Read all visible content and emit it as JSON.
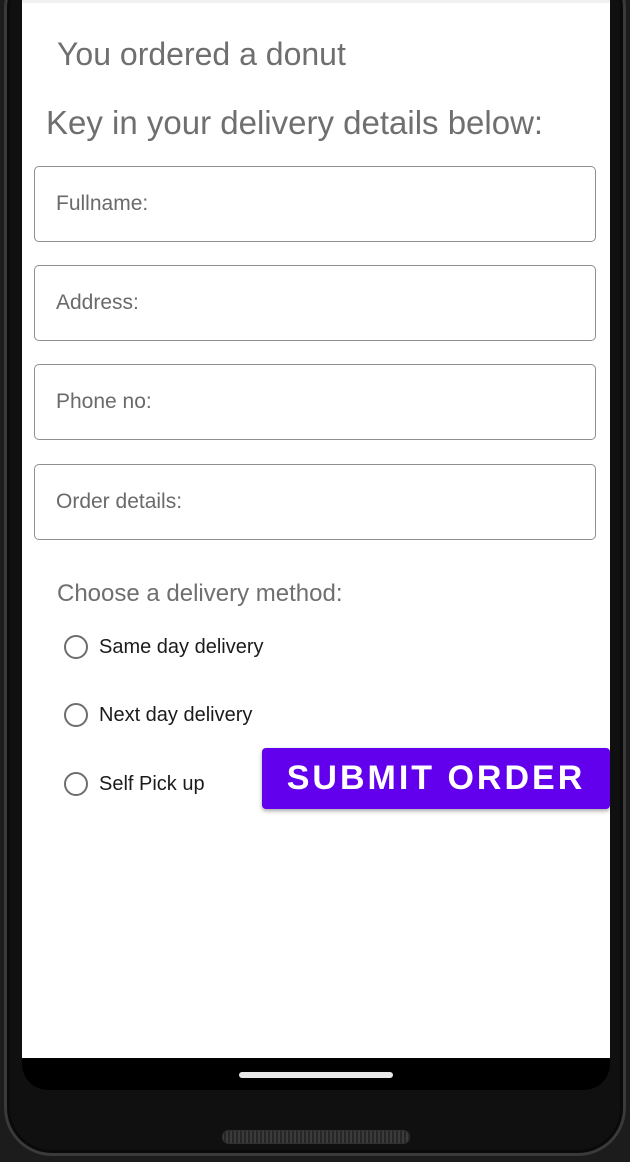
{
  "order_heading": "You ordered a donut",
  "prompt_heading": "Key in your delivery details below:",
  "fields": {
    "fullname": {
      "placeholder": "Fullname:",
      "value": ""
    },
    "address": {
      "placeholder": "Address:",
      "value": ""
    },
    "phone": {
      "placeholder": "Phone no:",
      "value": ""
    },
    "order_details": {
      "placeholder": "Order details:",
      "value": ""
    }
  },
  "delivery": {
    "label": "Choose a delivery method:",
    "options": [
      "Same day delivery",
      "Next day delivery",
      "Self Pick up"
    ],
    "selected": null
  },
  "submit_label": "SUBMIT ORDER",
  "colors": {
    "accent": "#6200ee",
    "heading_text": "#6f6f6f",
    "field_border": "#8f8f8f"
  }
}
